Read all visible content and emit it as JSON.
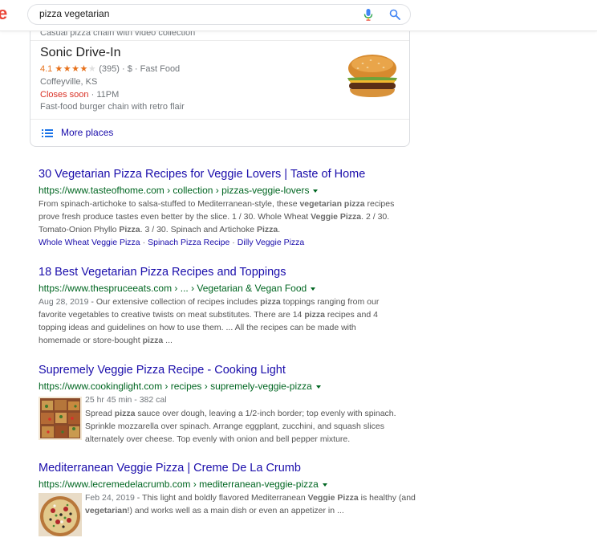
{
  "header": {
    "search_value": "pizza vegetarian"
  },
  "local_pack": {
    "previous_desc": "Casual pizza chain with video collection",
    "place": {
      "name": "Sonic Drive-In",
      "rating": "4.1",
      "stars": "★★★★",
      "half_star": "★",
      "reviews": "(395)",
      "price": "$",
      "category": "Fast Food",
      "location": "Coffeyville, KS",
      "status": "Closes soon",
      "hours": "11PM",
      "description": "Fast-food burger chain with retro flair"
    },
    "more_places_label": "More places"
  },
  "results": [
    {
      "title": "30 Vegetarian Pizza Recipes for Veggie Lovers | Taste of Home",
      "url": "https://www.tasteofhome.com › collection › pizzas-veggie-lovers",
      "snippet_parts": [
        "From spinach-artichoke to salsa-stuffed to Mediterranean-style, these ",
        "vegetarian pizza",
        " recipes prove fresh produce tastes even better by the slice. 1 / 30. Whole Wheat ",
        "Veggie Pizza",
        ". 2 / 30. Tomato-Onion Phyllo ",
        "Pizza",
        ". 3 / 30. Spinach and Artichoke ",
        "Pizza",
        "."
      ],
      "sitelinks": [
        "Whole Wheat Veggie Pizza",
        "Spinach Pizza Recipe",
        "Dilly Veggie Pizza"
      ],
      "sitelink_sep": "·"
    },
    {
      "title": "18 Best Vegetarian Pizza Recipes and Toppings",
      "url": "https://www.thespruceeats.com › ... › Vegetarian & Vegan Food",
      "date": "Aug 28, 2019",
      "snippet_parts": [
        " - Our extensive collection of recipes includes ",
        "pizza",
        " toppings ranging from our favorite vegetables to creative twists on meat substitutes. There are 14 ",
        "pizza",
        " recipes and 4 topping ideas and guidelines on how to use them. ... All the recipes can be made with homemade or store-bought ",
        "pizza",
        " ..."
      ]
    },
    {
      "title": "Supremely Veggie Pizza Recipe - Cooking Light",
      "url": "https://www.cookinglight.com › recipes › supremely-veggie-pizza",
      "meta": "25 hr 45 min - 382 cal",
      "snippet_parts": [
        "Spread ",
        "pizza",
        " sauce over dough, leaving a 1/2-inch border; top evenly with spinach. Sprinkle mozzarella over spinach. Arrange eggplant, zucchini, and squash slices alternately over cheese. Top evenly with onion and bell pepper mixture."
      ]
    },
    {
      "title": "Mediterranean Veggie Pizza | Creme De La Crumb",
      "url": "https://www.lecremedelacrumb.com › mediterranean-veggie-pizza",
      "date": "Feb 24, 2019",
      "snippet_parts": [
        " - This light and boldly flavored Mediterranean ",
        "Veggie Pizza",
        " is healthy (and ",
        "vegetarian",
        "!) and works well as a main dish or even an appetizer in ..."
      ]
    }
  ],
  "colors": {
    "link": "#1a0dab",
    "url": "#006621",
    "snippet": "#545454",
    "star": "#e7711b",
    "closing": "#d93025"
  }
}
